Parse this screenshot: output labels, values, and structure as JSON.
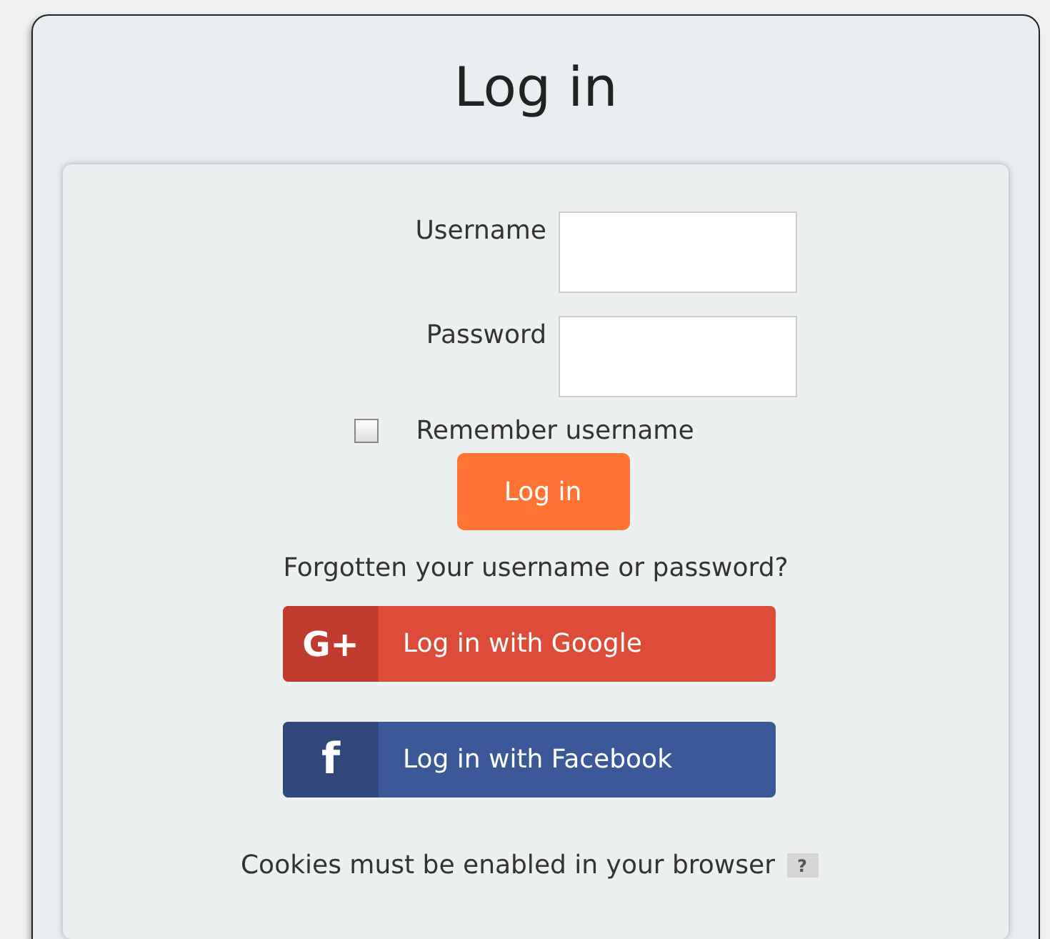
{
  "title": "Log in",
  "fields": [
    {
      "label": "Username"
    },
    {
      "label": "Password"
    }
  ],
  "remember": {
    "label": "Remember username",
    "checked": false
  },
  "login_button": "Log in",
  "forgot_link": "Forgotten your username or password?",
  "providers": [
    {
      "kind": "google",
      "label": "Log in with Google",
      "icon_text": "G+"
    },
    {
      "kind": "facebook",
      "label": "Log in with Facebook",
      "icon_text": "f"
    }
  ],
  "cookies_note": "Cookies must be enabled in your browser",
  "help_icon": "?"
}
